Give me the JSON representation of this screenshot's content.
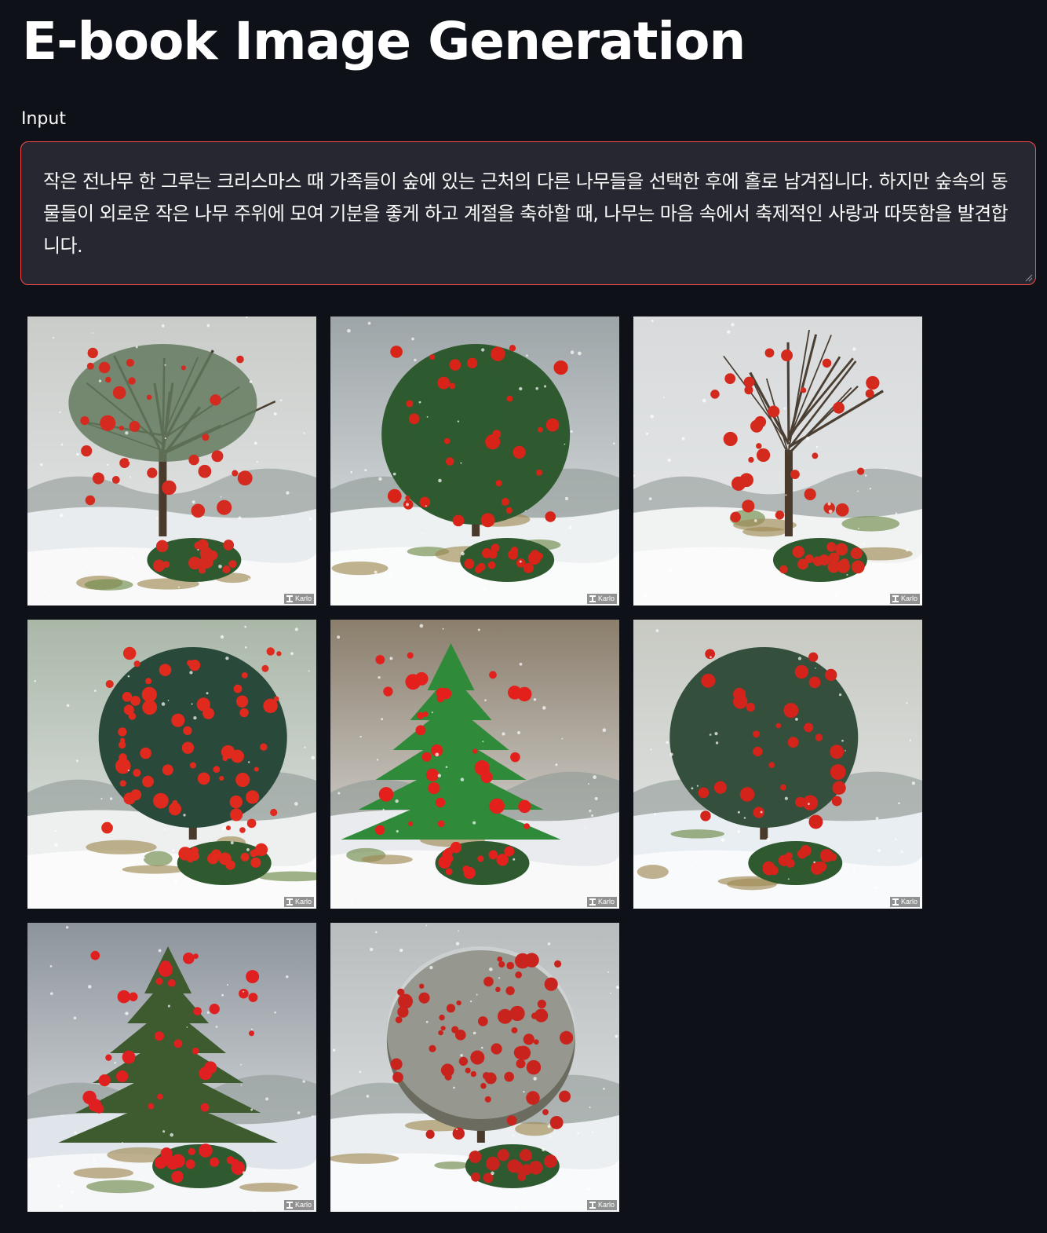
{
  "header": {
    "title": "E-book Image Generation"
  },
  "input": {
    "label": "Input",
    "value": "작은 전나무 한 그루는 크리스마스 때 가족들이 숲에 있는 근처의 다른 나무들을 선택한 후에 홀로 남겨집니다. 하지만 숲속의 동물들이 외로운 작은 나무 주위에 모여 기분을 좋게 하고 계절을 축하할 때, 나무는 마음 속에서 축제적인 사랑과 따뜻함을 발견합니다."
  },
  "gallery": {
    "watermark": "Karlo",
    "images": [
      {
        "sky": "#c9ccc8",
        "ground": "#e9ecef",
        "foliage": "#3e5b3a",
        "accent": "#d42a1f",
        "style": "bare-green"
      },
      {
        "sky": "#9da5a8",
        "ground": "#eef1f2",
        "foliage": "#2f5a30",
        "accent": "#d82318",
        "style": "bush-tree"
      },
      {
        "sky": "#d8dadb",
        "ground": "#f1f2f2",
        "foliage": "#5a4a3a",
        "accent": "#d32a1d",
        "style": "bare-red"
      },
      {
        "sky": "#aab7a8",
        "ground": "#eef0ef",
        "foliage": "#29493b",
        "accent": "#e02a1e",
        "style": "red-burst"
      },
      {
        "sky": "#8b7e6c",
        "ground": "#e9ebee",
        "foliage": "#2f8a3a",
        "accent": "#e3201c",
        "style": "pine-red"
      },
      {
        "sky": "#c7c9c2",
        "ground": "#e9eef3",
        "foliage": "#34503c",
        "accent": "#d4231b",
        "style": "holly"
      },
      {
        "sky": "#8d949c",
        "ground": "#dfe5ea",
        "foliage": "#3d5b2f",
        "accent": "#e02020",
        "style": "lone-pine"
      },
      {
        "sky": "#b8bcbd",
        "ground": "#eceff1",
        "foliage": "#6b6b5f",
        "accent": "#c8241d",
        "style": "frosted"
      }
    ]
  }
}
